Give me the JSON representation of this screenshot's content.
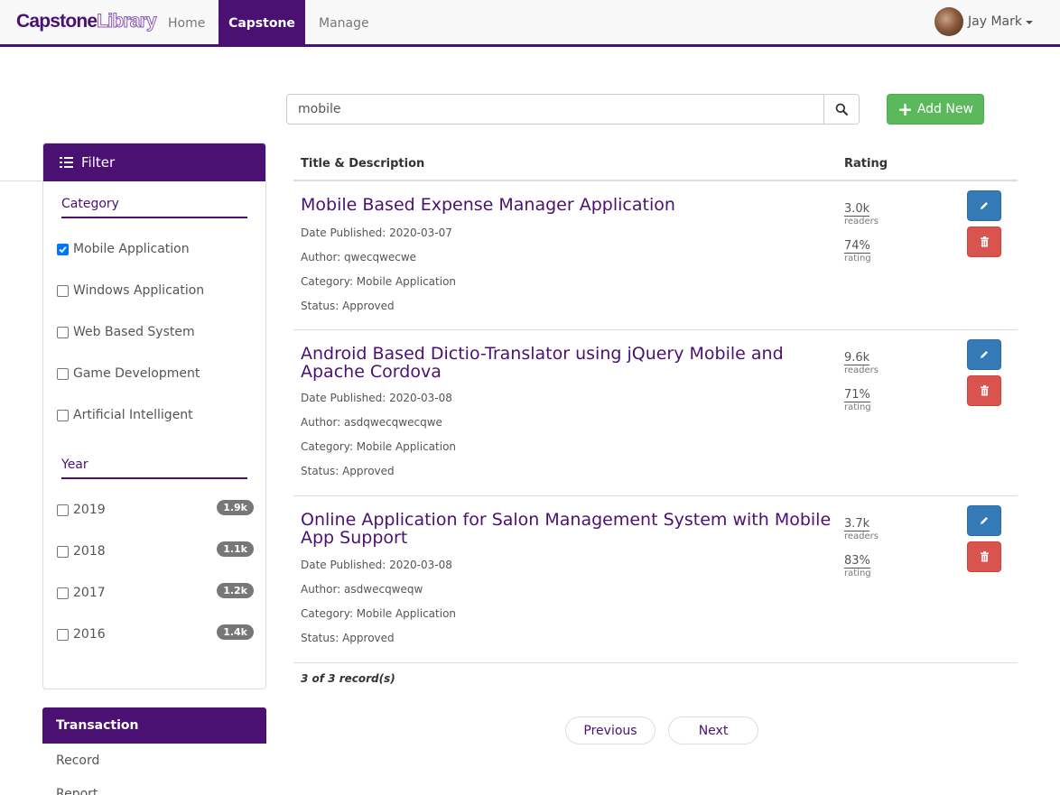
{
  "navbar": {
    "brand_part1": "Capstone",
    "brand_part2": "Library",
    "items": [
      "Home",
      "Capstone",
      "Manage"
    ],
    "active_item": "Capstone",
    "user_name": "Jay Mark"
  },
  "search": {
    "value": "mobile",
    "add_label": "Add New"
  },
  "filter": {
    "heading": "Filter",
    "category_title": "Category",
    "categories": [
      {
        "label": "Mobile Application",
        "checked": true
      },
      {
        "label": "Windows Application",
        "checked": false
      },
      {
        "label": "Web Based System",
        "checked": false
      },
      {
        "label": "Game Development",
        "checked": false
      },
      {
        "label": "Artificial Intelligent",
        "checked": false
      }
    ],
    "year_title": "Year",
    "years": [
      {
        "label": "2019",
        "count": "1.9k",
        "checked": false
      },
      {
        "label": "2018",
        "count": "1.1k",
        "checked": false
      },
      {
        "label": "2017",
        "count": "1.2k",
        "checked": false
      },
      {
        "label": "2016",
        "count": "1.4k",
        "checked": false
      }
    ]
  },
  "transaction": {
    "heading": "Transaction",
    "links": [
      "Record",
      "Report"
    ]
  },
  "table": {
    "col_title": "Title & Description",
    "col_rating": "Rating",
    "readers_label": "readers",
    "rating_label": "rating",
    "rows": [
      {
        "title": "Mobile Based Expense Manager Application",
        "date": "Date Published: 2020-03-07",
        "author": "Author: qwecqwecwe",
        "category": "Category: Mobile Application",
        "status": "Status: Approved",
        "readers": "3.0k",
        "rating": "74%"
      },
      {
        "title": "Android Based Dictio-Translator using jQuery Mobile and Apache Cordova",
        "date": "Date Published: 2020-03-08",
        "author": "Author: asdqwecqwecqwe",
        "category": "Category: Mobile Application",
        "status": "Status: Approved",
        "readers": "9.6k",
        "rating": "71%"
      },
      {
        "title": "Online Application for Salon Management System with Mobile App Support",
        "date": "Date Published: 2020-03-08",
        "author": "Author: asdwecqweqw",
        "category": "Category: Mobile Application",
        "status": "Status: Approved",
        "readers": "3.7k",
        "rating": "83%"
      }
    ],
    "record_count": "3 of 3 record(s)"
  },
  "pager": {
    "prev": "Previous",
    "next": "Next"
  },
  "colors": {
    "brand": "#4a1173",
    "success": "#5cb85c",
    "primary": "#337ab7",
    "danger": "#d9534f"
  }
}
